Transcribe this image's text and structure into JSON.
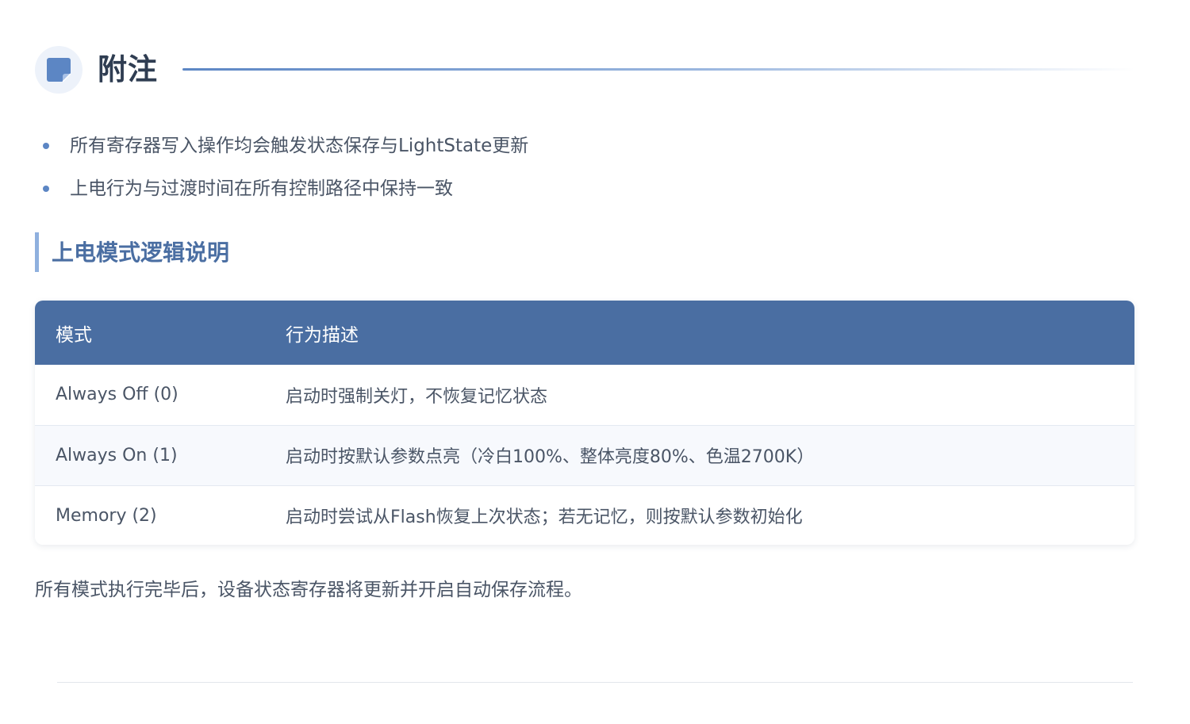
{
  "section": {
    "title": "附注",
    "icon": "sticky-note-icon",
    "accent_color": "#5c86c4"
  },
  "bullets": [
    "所有寄存器写入操作均会触发状态保存与LightState更新",
    "上电行为与过渡时间在所有控制路径中保持一致"
  ],
  "subsection": {
    "title": "上电模式逻辑说明"
  },
  "table": {
    "header_color": "#4a6ea2",
    "columns": [
      "模式",
      "行为描述"
    ],
    "rows": [
      [
        "Always Off (0)",
        "启动时强制关灯，不恢复记忆状态"
      ],
      [
        "Always On (1)",
        "启动时按默认参数点亮（冷白100%、整体亮度80%、色温2700K）"
      ],
      [
        "Memory (2)",
        "启动时尝试从Flash恢复上次状态；若无记忆，则按默认参数初始化"
      ]
    ]
  },
  "footer_note": "所有模式执行完毕后，设备状态寄存器将更新并开启自动保存流程。"
}
